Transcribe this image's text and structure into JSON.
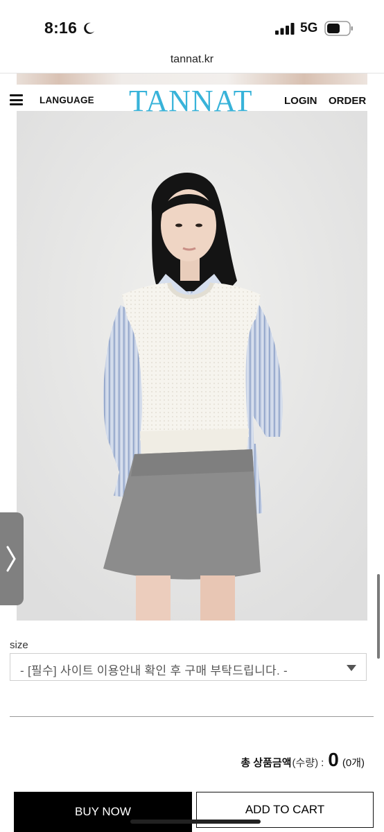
{
  "status_bar": {
    "time": "8:16",
    "network": "5G",
    "icons": [
      "moon-icon",
      "signal-icon",
      "battery-icon"
    ]
  },
  "browser": {
    "url": "tannat.kr"
  },
  "header": {
    "menu_icon": "hamburger-menu-icon",
    "language": "LANGUAGE",
    "logo": "TANNAT",
    "login": "LOGIN",
    "order": "ORDER",
    "logo_color": "#38b3d9"
  },
  "product": {
    "image": "model-photo (white knit vest, blue striped shirt, grey mini skirt)"
  },
  "options": {
    "size_label": "size",
    "size_selected": "- [필수] 사이트 이용안내 확인 후 구매 부탁드립니다. -"
  },
  "total": {
    "label": "총 상품금액",
    "qty_label": "(수량)",
    "colon": ":",
    "amount": "0",
    "count": "(0개)"
  },
  "actions": {
    "buy_now": "BUY NOW",
    "add_to_cart": "ADD TO CART"
  }
}
